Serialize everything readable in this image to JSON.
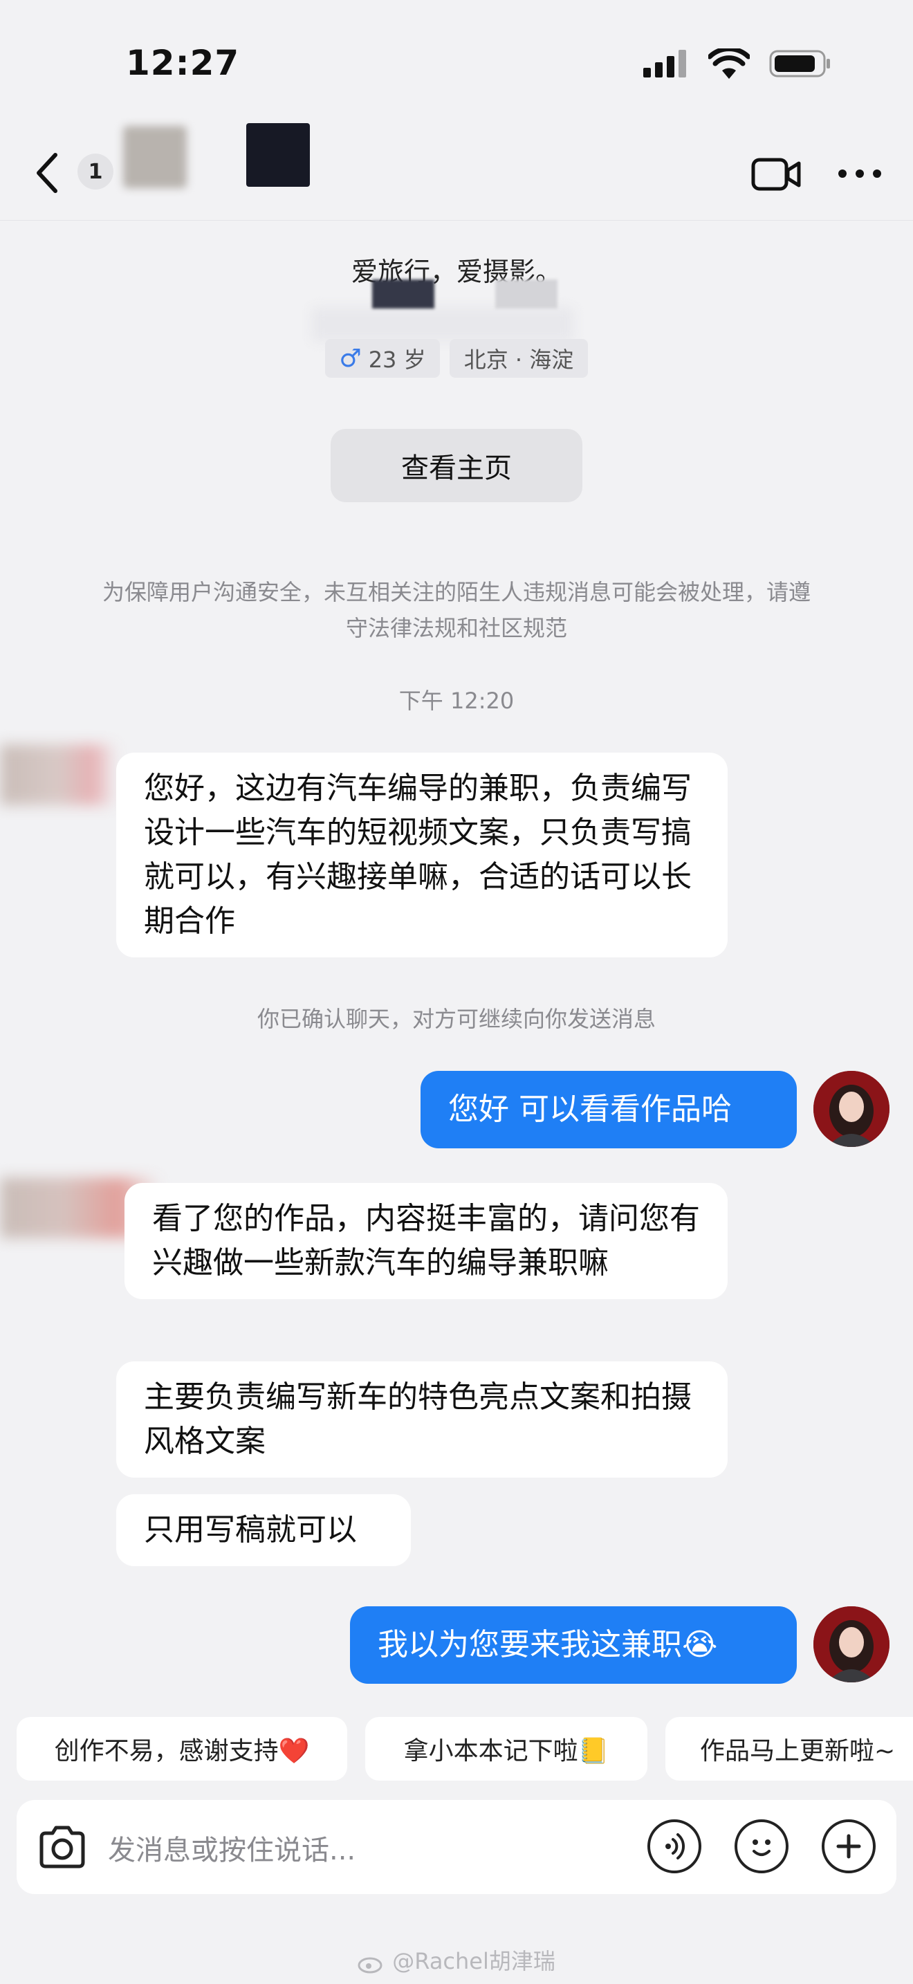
{
  "status_bar": {
    "time": "12:27"
  },
  "header": {
    "unread_count": "1"
  },
  "profile": {
    "bio": "爱旅行，爱摄影。",
    "age_tag": "23 岁",
    "gender_symbol": "♂",
    "location_tag": "北京 · 海淀",
    "home_button": "查看主页"
  },
  "chat": {
    "safety_notice": "为保障用户沟通安全，未互相关注的陌生人违规消息可能会被处理，请遵守法律法规和社区规范",
    "timestamp": "下午 12:20",
    "confirm_note": "你已确认聊天，对方可继续向你发送消息",
    "messages": [
      {
        "from": "peer",
        "text": "您好，这边有汽车编导的兼职，负责编写设计一些汽车的短视频文案，只负责写搞就可以，有兴趣接单嘛，合适的话可以长期合作"
      },
      {
        "from": "me",
        "text": "您好 可以看看作品哈"
      },
      {
        "from": "peer",
        "text": "看了您的作品，内容挺丰富的，请问您有兴趣做一些新款汽车的编导兼职嘛"
      },
      {
        "from": "peer",
        "text": "主要负责编写新车的特色亮点文案和拍摄风格文案"
      },
      {
        "from": "peer",
        "text": "只用写稿就可以"
      },
      {
        "from": "me",
        "text": "我以为您要来我这兼职😭"
      }
    ]
  },
  "quick_replies": [
    "创作不易，感谢支持❤️",
    "拿小本本记下啦📒",
    "作品马上更新啦~"
  ],
  "composer": {
    "placeholder": "发消息或按住说话..."
  },
  "watermark": "@Rachel胡津瑞",
  "colors": {
    "accent": "#1f7ff5",
    "background": "#f2f2f4",
    "bubble_in": "#ffffff"
  },
  "icons": [
    "back-icon",
    "video-call-icon",
    "more-icon",
    "camera-icon",
    "voice-icon",
    "emoji-icon",
    "plus-icon",
    "weibo-icon"
  ]
}
